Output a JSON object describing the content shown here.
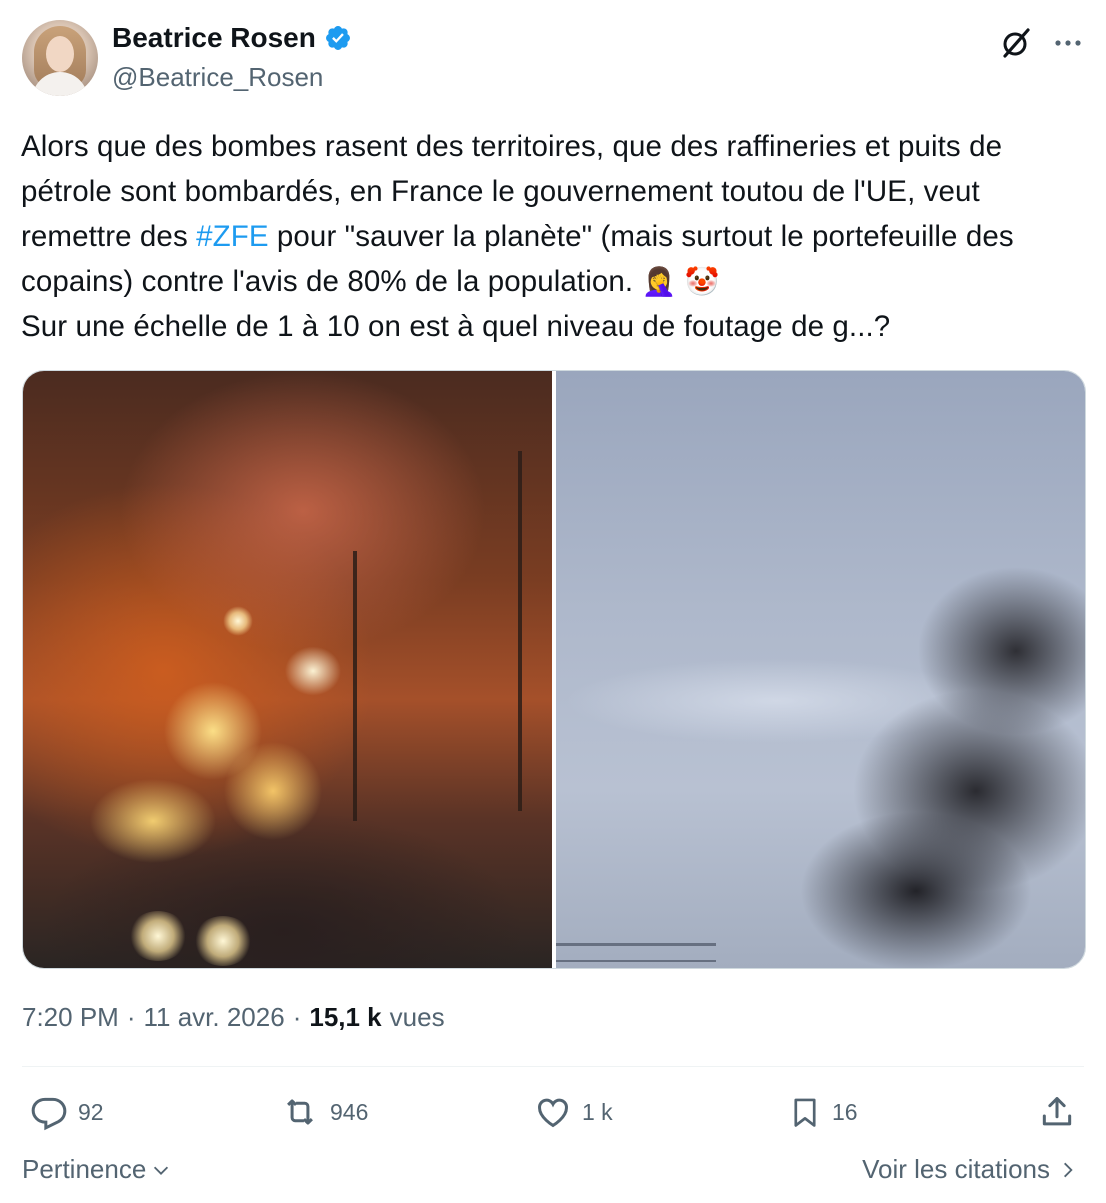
{
  "author": {
    "display_name": "Beatrice Rosen",
    "handle": "@Beatrice_Rosen",
    "verified": true
  },
  "header_icons": [
    "grok-icon",
    "more-icon"
  ],
  "tweet": {
    "text_before_hashtag": "Alors que des bombes rasent des territoires, que des raffineries et puits de pétrole sont bombardés, en France le gouvernement toutou de l'UE, veut remettre des ",
    "hashtag": "#ZFE",
    "text_after_hashtag": " pour \"sauver la planète\" (mais surtout le portefeuille des copains) contre l'avis de 80% de la population. ",
    "emoji_1": "🤦‍♀️",
    "emoji_2": "🤡",
    "text_line_last": "Sur une échelle de 1 à 10 on est à quel niveau de foutage de g...?"
  },
  "meta": {
    "time": "7:20 PM",
    "sep1": "·",
    "date": "11 avr. 2026",
    "sep2": "·",
    "views_count": "15,1 k",
    "views_label": "vues"
  },
  "actions": {
    "replies": "92",
    "reposts": "946",
    "likes": "1 k",
    "bookmarks": "16"
  },
  "footer": {
    "sort_label": "Pertinence",
    "quotes_label": "Voir les citations"
  },
  "colors": {
    "accent": "#1d9bf0",
    "secondary_text": "#536471",
    "primary_text": "#0f1419"
  }
}
